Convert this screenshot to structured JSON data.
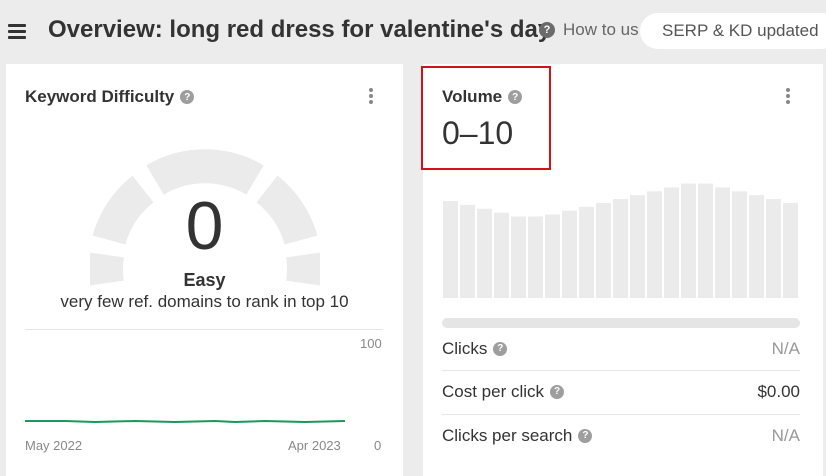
{
  "header": {
    "title": "Overview: long red dress for valentine's day",
    "help_label": "How to us",
    "serp_status": "SERP & KD updated"
  },
  "keyword_difficulty": {
    "title": "Keyword Difficulty",
    "score": "0",
    "level": "Easy",
    "description": "very few ref. domains to rank in top 10",
    "trend": {
      "max_label": "100",
      "min_label": "0",
      "start_label": "May 2022",
      "end_label": "Apr 2023",
      "line_color": "#1a9a5a"
    }
  },
  "volume": {
    "title": "Volume",
    "value": "0–10",
    "highlight_color": "#d0121b",
    "bar_levels": [
      1.0,
      0.96,
      0.92,
      0.88,
      0.84,
      0.84,
      0.86,
      0.9,
      0.94,
      0.98,
      1.02,
      1.06,
      1.1,
      1.14,
      1.18,
      1.18,
      1.14,
      1.1,
      1.06,
      1.02,
      0.98
    ],
    "metrics": [
      {
        "label": "Clicks",
        "value": "N/A"
      },
      {
        "label": "Cost per click",
        "value": "$0.00"
      },
      {
        "label": "Clicks per search",
        "value": "N/A"
      }
    ]
  },
  "icons": {
    "menu": "hamburger-icon",
    "help": "question-icon",
    "more": "kebab-icon"
  }
}
